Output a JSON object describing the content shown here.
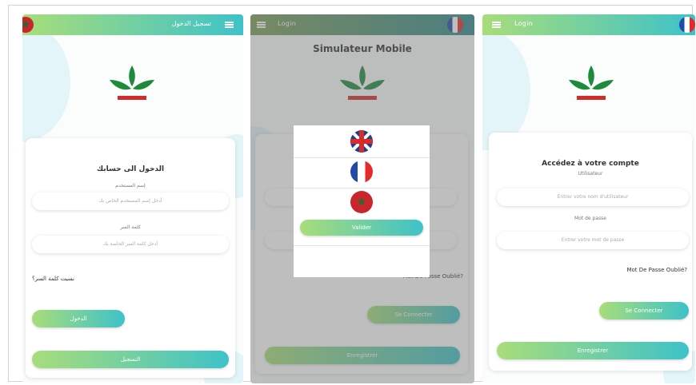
{
  "colors": {
    "gradient_start": "#a8dd7a",
    "gradient_end": "#3ec2c9",
    "logo_leaf": "#1e8a3c",
    "logo_bar": "#d42a2a"
  },
  "screen_arabic": {
    "topbar_title": "تسجيل الدخول",
    "card_heading": "الدخول الى حسابك",
    "username_label": "إسم المستخدم",
    "username_placeholder": "أدخل إسم المستخدم الخاص بك",
    "password_label": "كلمة السر",
    "password_placeholder": "أدخل كلمة السر الخاصة بك",
    "forgot_link": "نسيت كلمة السر؟",
    "login_button": "الدخول",
    "register_button": "التسجيل"
  },
  "screen_language": {
    "topbar_title": "Login",
    "app_title": "Simulateur Mobile",
    "languages": [
      "English",
      "Français",
      "العربية"
    ],
    "continue_button": "Valider",
    "forgot_link": "Mot De Passe Oublié?",
    "login_button": "Se Connecter",
    "register_button": "Enregistrer"
  },
  "screen_french": {
    "topbar_title": "Login",
    "card_heading": "Accédez à votre compte",
    "username_label": "Utilisateur",
    "username_placeholder": "Entrer votre nom d'utilisateur",
    "password_label": "Mot de passe",
    "password_placeholder": "Entrer votre mot de passe",
    "forgot_link": "Mot De Passe Oublié?",
    "login_button": "Se Connecter",
    "register_button": "Enregistrer"
  }
}
